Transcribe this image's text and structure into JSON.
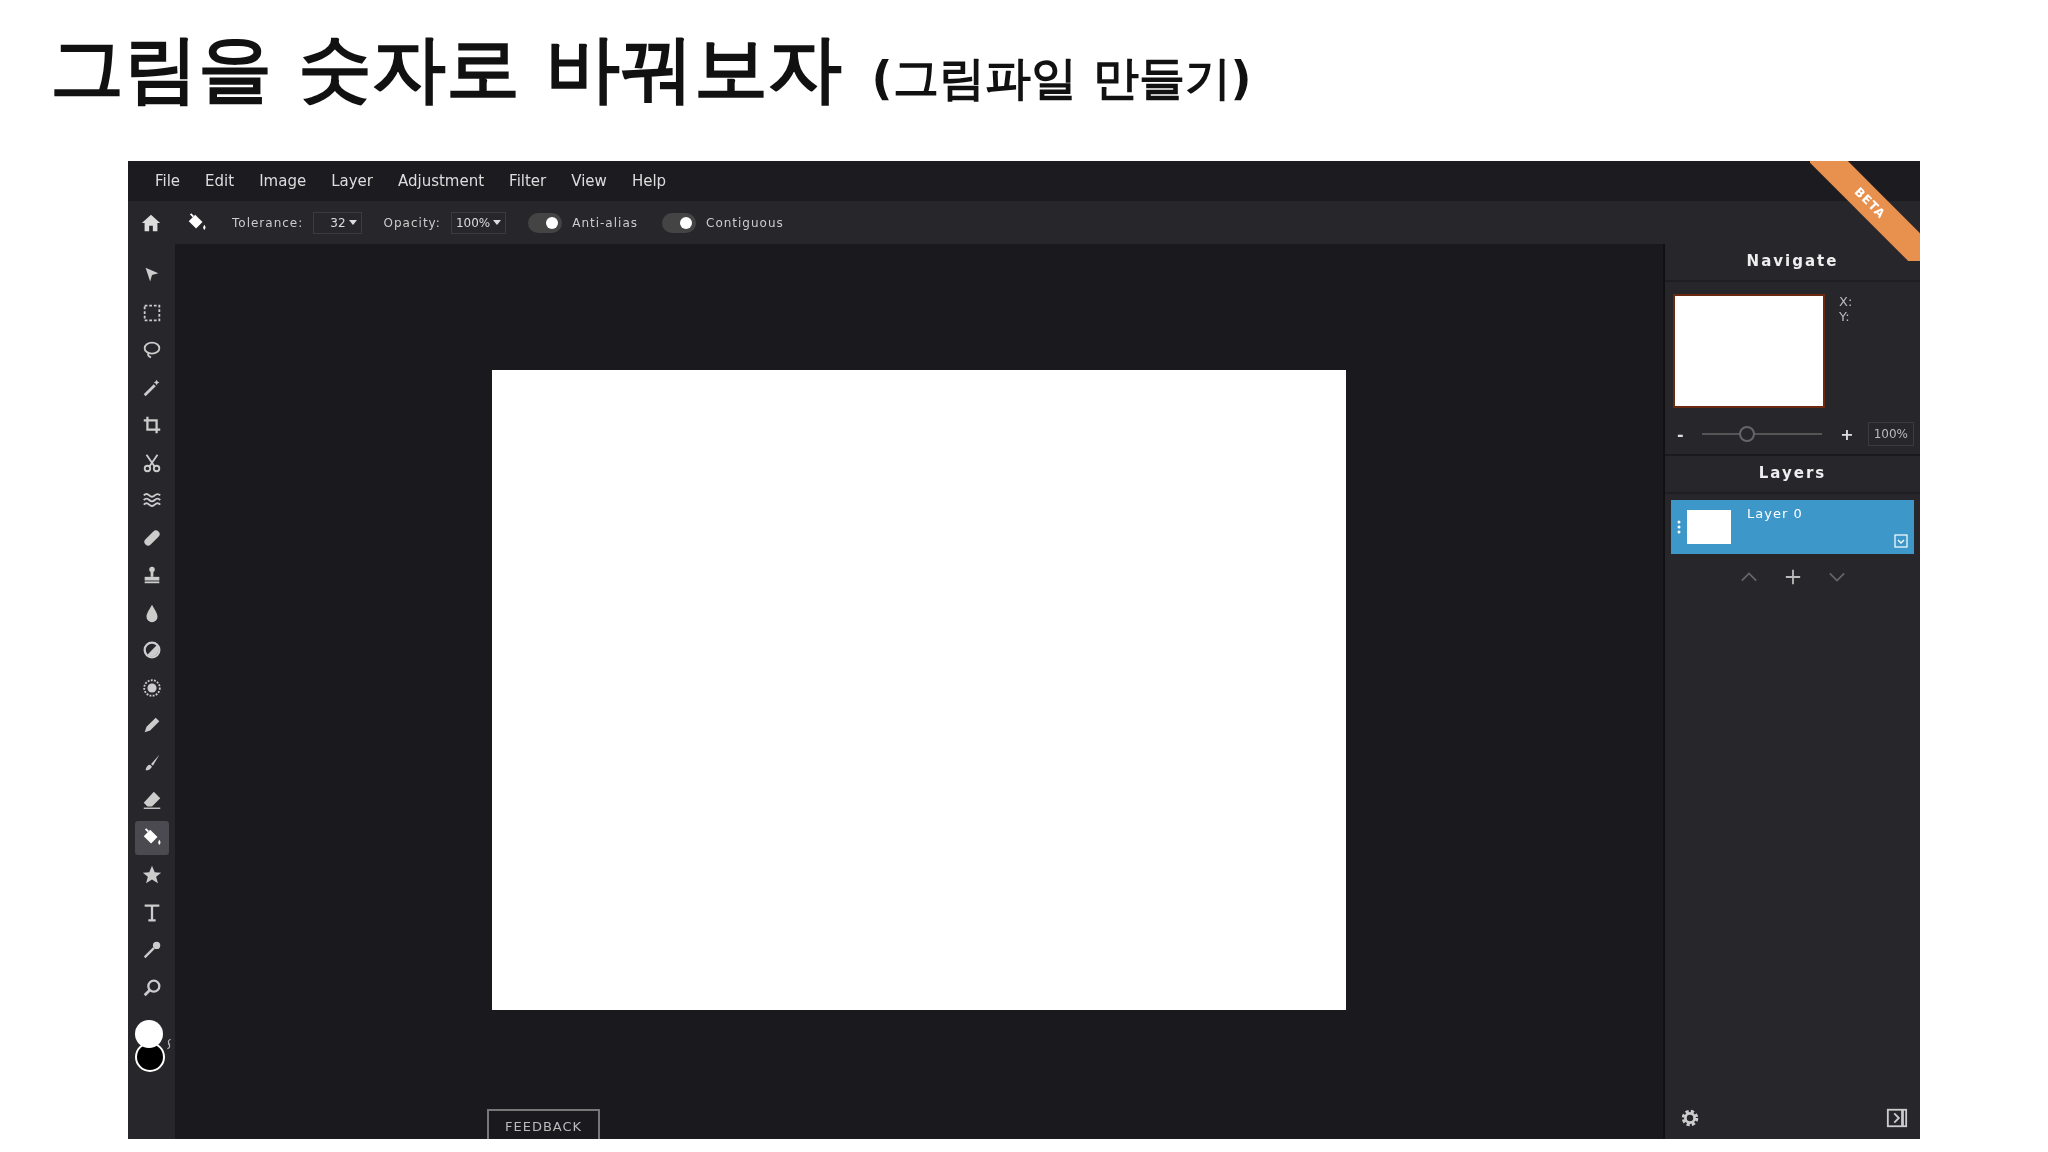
{
  "slide_title": {
    "main": "그림을 숫자로 바꿔보자",
    "sub": "(그림파일 만들기)"
  },
  "menu": [
    "File",
    "Edit",
    "Image",
    "Layer",
    "Adjustment",
    "Filter",
    "View",
    "Help"
  ],
  "options": {
    "tolerance": {
      "label": "Tolerance:",
      "value": "32"
    },
    "opacity": {
      "label": "Opacity:",
      "value": "100%"
    },
    "toggles": [
      {
        "label": "Anti-alias",
        "on": true
      },
      {
        "label": "Contiguous",
        "on": true
      }
    ]
  },
  "badge": "BETA",
  "tools": [
    {
      "kind": "arrow",
      "selected": false
    },
    {
      "kind": "marquee",
      "selected": false
    },
    {
      "kind": "lasso",
      "selected": false
    },
    {
      "kind": "wand",
      "selected": false
    },
    {
      "kind": "crop",
      "selected": false
    },
    {
      "kind": "scissors",
      "selected": false
    },
    {
      "kind": "waves",
      "selected": false
    },
    {
      "kind": "bandage",
      "selected": false
    },
    {
      "kind": "stamp",
      "selected": false
    },
    {
      "kind": "drop",
      "selected": false
    },
    {
      "kind": "contrast",
      "selected": false
    },
    {
      "kind": "sun",
      "selected": false
    },
    {
      "kind": "pen",
      "selected": false
    },
    {
      "kind": "brush",
      "selected": false
    },
    {
      "kind": "eraser",
      "selected": false
    },
    {
      "kind": "bucket",
      "selected": true
    },
    {
      "kind": "star",
      "selected": false
    },
    {
      "kind": "text",
      "selected": false
    },
    {
      "kind": "dropper",
      "selected": false
    },
    {
      "kind": "zoom",
      "selected": false
    }
  ],
  "navigate": {
    "title": "Navigate",
    "x_label": "X:",
    "y_label": "Y:",
    "zoom_minus": "-",
    "zoom_plus": "+",
    "level": 0.38,
    "zoom": "100%"
  },
  "layers": {
    "title": "Layers",
    "items": [
      {
        "name": "Layer 0",
        "selected": true,
        "visible": true
      }
    ]
  },
  "feedback": "FEEDBACK"
}
